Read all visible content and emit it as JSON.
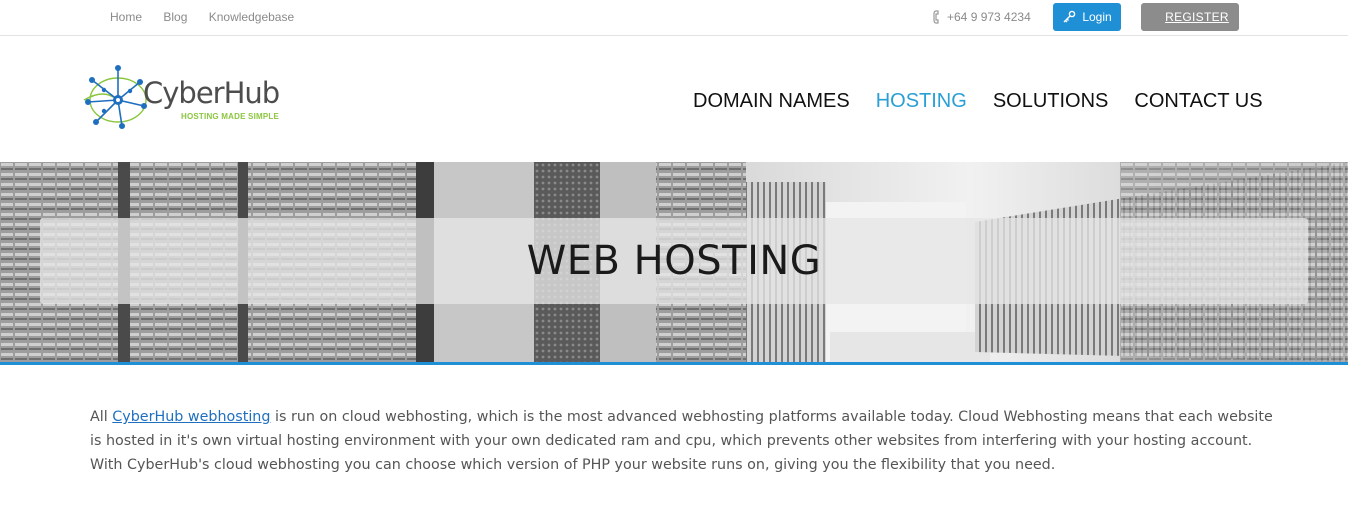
{
  "topbar": {
    "links": [
      "Home",
      "Blog",
      "Knowledgebase"
    ],
    "phone": "+64 9 973 4234",
    "login_label": "Login",
    "register_label": "REGISTER"
  },
  "logo": {
    "name": "CyberHub",
    "tagline": "HOSTING MADE SIMPLE"
  },
  "nav": {
    "items": [
      "DOMAIN NAMES",
      "HOSTING",
      "SOLUTIONS",
      "CONTACT US"
    ],
    "active": "HOSTING"
  },
  "banner": {
    "title": "WEB HOSTING"
  },
  "content": {
    "intro_before": "All ",
    "link_text": "CyberHub webhosting",
    "intro_after": " is run on cloud webhosting, which is the most advanced webhosting platforms available today. Cloud Webhosting means that each website is hosted in it's own virtual hosting environment with your own dedicated ram and cpu, which prevents other websites from interfering with your hosting account. With CyberHub's cloud webhosting you can choose which version of PHP your website runs on, giving you the flexibility that you need."
  },
  "colors": {
    "accent": "#1f8fd6",
    "register_bg": "#8c8c8c",
    "nav_active": "#2a9fd6",
    "logo_green": "#8cc63f"
  }
}
